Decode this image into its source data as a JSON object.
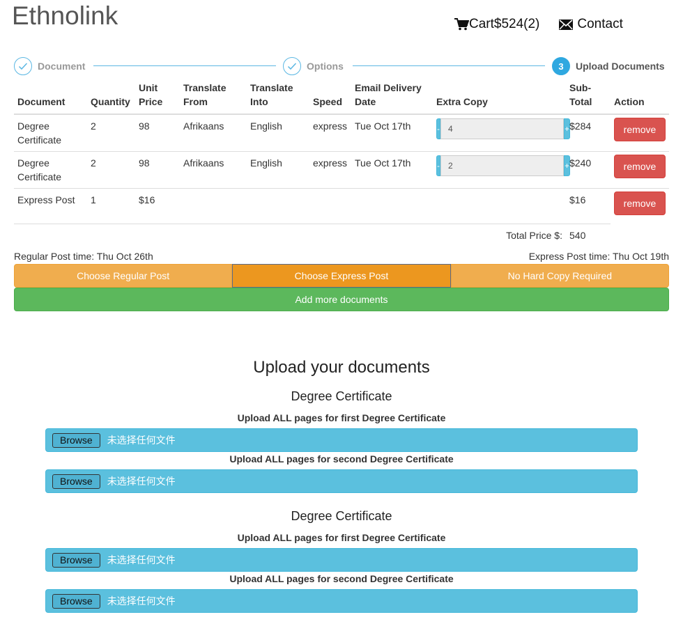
{
  "header": {
    "brand": "Ethnolink",
    "cart_label": "Cart$524(2)",
    "contact_label": "Contact"
  },
  "stepper": {
    "steps": [
      {
        "label": "Document",
        "state": "done"
      },
      {
        "label": "Options",
        "state": "done"
      },
      {
        "label": "Upload Documents",
        "state": "active",
        "number": "3"
      }
    ]
  },
  "table": {
    "headers": {
      "document": "Document",
      "quantity": "Quantity",
      "unit_price": "Unit Price",
      "translate_from": "Translate From",
      "translate_into": "Translate Into",
      "speed": "Speed",
      "delivery": "Email Delivery Date",
      "extra_copy": "Extra Copy",
      "subtotal": "Sub-Total",
      "action": "Action"
    },
    "rows": [
      {
        "document": "Degree Certificate",
        "quantity": "2",
        "unit_price": "98",
        "from": "Afrikaans",
        "into": "English",
        "speed": "express",
        "delivery": "Tue Oct 17th",
        "extra_copy": "4",
        "subtotal": "$284",
        "remove": "remove"
      },
      {
        "document": "Degree Certificate",
        "quantity": "2",
        "unit_price": "98",
        "from": "Afrikaans",
        "into": "English",
        "speed": "express",
        "delivery": "Tue Oct 17th",
        "extra_copy": "2",
        "subtotal": "$240",
        "remove": "remove"
      },
      {
        "document": "Express Post",
        "quantity": "1",
        "unit_price": "$16",
        "subtotal": "$16",
        "remove": "remove"
      }
    ],
    "stepper_minus": "-",
    "stepper_plus": "+",
    "total_label": "Total Price $:",
    "total_value": "540"
  },
  "post": {
    "regular_time": "Regular Post time: Thu Oct 26th",
    "express_time": "Express Post time: Thu Oct 19th",
    "options": [
      "Choose Regular Post",
      "Choose Express Post",
      "No Hard Copy Required"
    ],
    "selected_index": 1,
    "add_more": "Add more documents"
  },
  "upload": {
    "title": "Upload your documents",
    "groups": [
      {
        "title": "Degree Certificate",
        "fields": [
          {
            "label": "Upload ALL pages for first Degree Certificate",
            "browse": "Browse",
            "file": "未选择任何文件"
          },
          {
            "label": "Upload ALL pages for second Degree Certificate",
            "browse": "Browse",
            "file": "未选择任何文件"
          }
        ]
      },
      {
        "title": "Degree Certificate",
        "fields": [
          {
            "label": "Upload ALL pages for first Degree Certificate",
            "browse": "Browse",
            "file": "未选择任何文件"
          },
          {
            "label": "Upload ALL pages for second Degree Certificate",
            "browse": "Browse",
            "file": "未选择任何文件"
          }
        ]
      }
    ]
  },
  "colors": {
    "step_accent": "#2fa8e0",
    "remove": "#d9534f",
    "post_option": "#f0ad4e",
    "post_selected": "#ec971f",
    "add_more": "#5cb85c",
    "upload_box": "#5bc0de"
  }
}
